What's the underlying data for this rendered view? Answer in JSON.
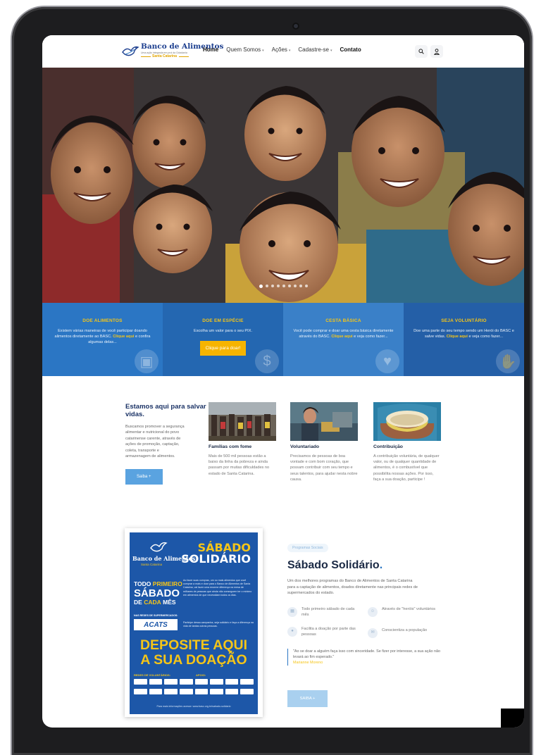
{
  "header": {
    "logo_title": "Banco de Alimentos",
    "logo_tagline": "Uma ação integrada em prol da Cidadania",
    "logo_region": "Santa Catarina",
    "nav": [
      {
        "label": "Home",
        "current": true,
        "dropdown": false
      },
      {
        "label": "Quem Somos",
        "current": false,
        "dropdown": true
      },
      {
        "label": "Ações",
        "current": false,
        "dropdown": true
      },
      {
        "label": "Cadastre-se",
        "current": false,
        "dropdown": true
      },
      {
        "label": "Contato",
        "current": false,
        "dropdown": false
      }
    ],
    "search_icon": "search-icon",
    "user_icon": "user-icon"
  },
  "hero": {
    "slides_count": 9,
    "active_slide": 1
  },
  "panels": [
    {
      "title": "DOE ALIMENTOS",
      "text_before": "Existem várias maneiras de você participar doando alimentos diretamente ao BASC. ",
      "link": "Clique aqui",
      "text_after": " e confira algumas delas...",
      "icon": "box-icon"
    },
    {
      "title": "DOE EM ESPÉCIE",
      "text": "Escolha um valor para o seu PIX.",
      "button": "Clique para doar!",
      "icon": "money-icon"
    },
    {
      "title": "CESTA BÁSICA",
      "text_before": "Você pode comprar e doar uma cesta básica diretamente através do BASC. ",
      "link": "Clique aqui",
      "text_after": " e veja como fazer...",
      "icon": "heart-icon"
    },
    {
      "title": "SEJA VOLUNTÁRIO",
      "text_before": "Doe uma parte do seu tempo sendo um Herói do BASC e salve vidas. ",
      "link": "Clique aqui",
      "text_after": " e veja como fazer...",
      "icon": "hand-icon"
    }
  ],
  "about": {
    "title": "Estamos aqui para salvar vidas.",
    "text": "Buscamos promover a segurança alimentar e nutricional do povo catarinense carente, através de ações de promoção, captação, coleta, transporte e armazenagem de alimentos.",
    "button": "Saiba +"
  },
  "cards": [
    {
      "title": "Famílias com fome",
      "text": "Mais de 500 mil pessoas estão a baixo da linha da pobreza e ainda passam por muitas dificuldades no estado de Santa Catarina."
    },
    {
      "title": "Voluntariado",
      "text": "Precisamos de pessoas de boa vontade e com bom coração, que possam contribuir com seu tempo e seus talentos, para ajudar nesta nobre causa."
    },
    {
      "title": "Contribuição",
      "text": "A contribuição voluntária, de qualquer valor, ou de qualquer quantidade de alimentos, é o combustível que possibilita nossas ações. Por isso, faça a sua doação, participe !"
    }
  ],
  "poster": {
    "logo_title": "Banco de Alimentos",
    "logo_region": "Santa Catarina",
    "headline_a": "SÁBADO",
    "headline_b": "SOLIDÁRIO",
    "todo_a": "TODO",
    "todo_b": "PRIMEIRO",
    "todo_c": "SÁBADO",
    "todo_d": "DE",
    "todo_e": "CADA",
    "todo_f": "MÊS",
    "text1": "Ao fazer suas compras, um ou mais alimentos que você comprar a mais e doar para o Banco de Alimentos de Santa Catarina, vai fazer uma enorme diferença na mesa de milhares de pessoas que ainda não conseguem ter o mínimo em alimentos de que necessitam todos os dias.",
    "text2": "Participe dessa campanha, seja solidário e faça a diferença na vida de tantas outras pessoas.",
    "redes_label": "NAS REDES DE SUPERMERCADOS:",
    "acats": "ACATS",
    "deposite_a": "DEPOSITE AQUI",
    "deposite_b": "A SUA DOAÇÃO",
    "voluntarios_label": "REDES DE VOLUNTÁRIOS:",
    "apoio_label": "APOIO:",
    "footer": "Para mais informações acesse: www.basc.org.br/sabado-solidario"
  },
  "sabado": {
    "tag": "Programas Sociais",
    "title": "Sábado Solidário",
    "title_dot": ".",
    "desc": "Um dos melhores programas do Banco de Alimentos de Santa Catarina para a captação de alimentos, doados diretamente nas principais redes de supermercados do estado.",
    "features": [
      {
        "text": "Todo primeiro sábado de cada mês",
        "icon": "calendar-icon"
      },
      {
        "text": "Através de \"heróis\" voluntários",
        "icon": "people-icon"
      },
      {
        "text": "Facilita a doação por parte das pessoas",
        "icon": "user-icon"
      },
      {
        "text": "Conscientiza a população",
        "icon": "chat-icon"
      }
    ],
    "quote": "\"Ao se doar a alguém faça isso com sinceridade. Se fizer por interesse, a sua ação não levará ao fim esperado.\"",
    "quote_author": "Marianne Moreno",
    "button": "SAIBA +"
  },
  "colors": {
    "primary_blue": "#2b76c4",
    "dark_navy": "#1b3366",
    "accent_yellow": "#f5c518",
    "button_orange": "#f6b400"
  }
}
